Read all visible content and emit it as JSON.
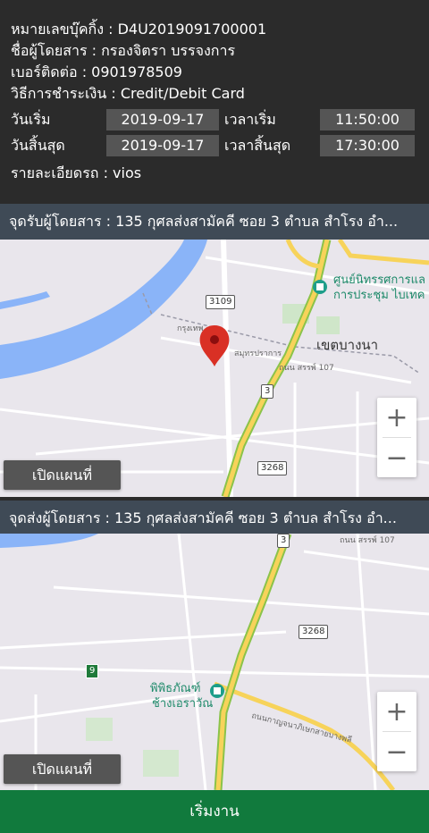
{
  "booking": {
    "number_line": "หมายเลขบุ๊คกิ้ง : D4U2019091700001",
    "passenger_line": "ชื่อผู้โดยสาร : กรองจิตรา บรรจงการ",
    "phone_line": "เบอร์ติดต่อ : 0901978509",
    "payment_line": "วิธีการชำระเงิน : Credit/Debit Card",
    "start_date_label": "วันเริ่ม",
    "start_date": "2019-09-17",
    "start_time_label": "เวลาเริ่ม",
    "start_time": "11:50:00",
    "end_date_label": "วันสิ้นสุด",
    "end_date": "2019-09-17",
    "end_time_label": "เวลาสิ้นสุด",
    "end_time": "17:30:00",
    "car_line": "รายละเอียดรถ : vios"
  },
  "pickup": {
    "address": "จุดรับผู้โดยสาร : 135 กุศลส่งสามัคคี ซอย 3 ตำบล สำโรง อำ...",
    "open_map_label": "เปิดแผนที่",
    "map_labels": {
      "poi_line1": "ศูนย์นิทรรศการแล",
      "poi_line2": "การประชุม ไบเทค",
      "district": "เขตบางนา",
      "road_a": "กรุงเทพ",
      "road_b": "สมุทรปราการ",
      "road_c": "ถนน สรรพ์ 107",
      "shield_3109": "3109",
      "shield_3": "3",
      "shield_3268": "3268"
    }
  },
  "dropoff": {
    "address": "จุดส่งผู้โดยสาร : 135 กุศลส่งสามัคคี ซอย 3 ตำบล สำโรง อำ...",
    "open_map_label": "เปิดแผนที่",
    "map_labels": {
      "poi_line1": "พิพิธภัณฑ์",
      "poi_line2": "ช้างเอราวัณ",
      "road_c": "ถนน สรรพ์ 107",
      "road_d": "ถนนกาญจนาภิเษกสายบางพลี",
      "shield_3": "3",
      "shield_3268": "3268",
      "shield_9": "9"
    }
  },
  "zoom": {
    "in": "+",
    "out": "−"
  },
  "footer": {
    "start_label": "เริ่มงาน"
  },
  "colors": {
    "header_bg": "#2b2b2b",
    "address_bar": "#3f4a56",
    "start_button": "#117a3d",
    "river": "#8ab4f8",
    "main_road": "#f7d35a"
  }
}
